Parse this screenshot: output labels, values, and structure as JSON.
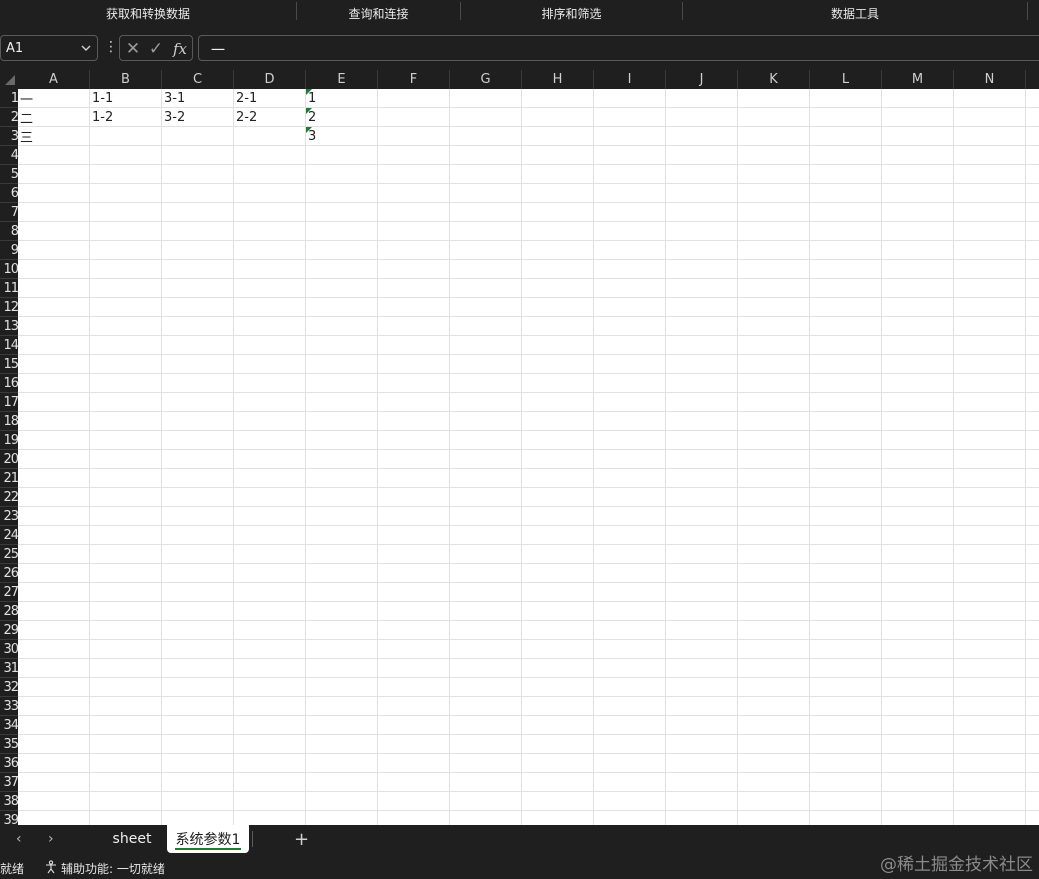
{
  "ribbon": {
    "groups": [
      "获取和转换数据",
      "查询和连接",
      "排序和筛选",
      "数据工具"
    ]
  },
  "formula_bar": {
    "name_box": "A1",
    "more_glyph": "⋮",
    "cancel_glyph": "✕",
    "enter_glyph": "✓",
    "fx_label": "fx",
    "formula": "一"
  },
  "columns": [
    "A",
    "B",
    "C",
    "D",
    "E",
    "F",
    "G",
    "H",
    "I",
    "J",
    "K",
    "L",
    "M",
    "N"
  ],
  "rows": [
    "1",
    "2",
    "3",
    "4",
    "5",
    "6",
    "7",
    "8",
    "9",
    "10",
    "11",
    "12",
    "13",
    "14",
    "15",
    "16",
    "17",
    "18",
    "19",
    "20",
    "21",
    "22",
    "23",
    "24",
    "25",
    "26",
    "27",
    "28",
    "29",
    "30",
    "31",
    "32",
    "33",
    "34",
    "35",
    "36",
    "37",
    "38",
    "39"
  ],
  "cells": {
    "A1": "一",
    "B1": "1-1",
    "C1": "3-1",
    "D1": "2-1",
    "E1": "1",
    "A2": "二",
    "B2": "1-2",
    "C2": "3-2",
    "D2": "2-2",
    "E2": "2",
    "A3": "三",
    "E3": "3"
  },
  "sheets": {
    "prev_glyph": "‹",
    "next_glyph": "›",
    "tabs": [
      "sheet",
      "系统参数1"
    ],
    "active": "系统参数1",
    "add_glyph": "+"
  },
  "status": {
    "ready": "就绪",
    "accessibility": "辅助功能: 一切就绪",
    "watermark": "@稀土掘金技术社区"
  },
  "colors": {
    "accent_green": "#1e7b34",
    "chrome_bg": "#1f1f1f",
    "grid_line": "#e1e1e1"
  }
}
